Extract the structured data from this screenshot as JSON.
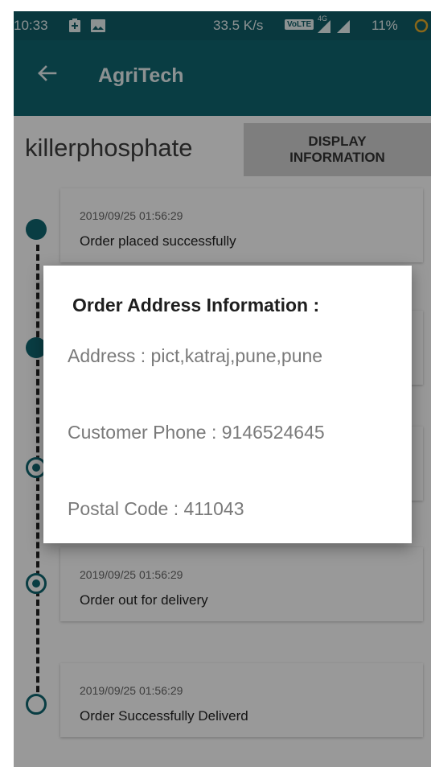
{
  "status_bar": {
    "time": "10:33",
    "speed": "33.5 K/s",
    "network_badge": "VoLTE",
    "signal_label": "4G",
    "battery": "11%"
  },
  "app_bar": {
    "title": "AgriTech"
  },
  "header": {
    "product_name": "killerphosphate",
    "display_button": "DISPLAY\nINFORMATION"
  },
  "timeline": [
    {
      "timestamp": "2019/09/25 01:56:29",
      "status": "Order placed successfully"
    },
    {
      "timestamp": "2019/09/25 01:56:29",
      "status": "Order out for delivery"
    },
    {
      "timestamp": "2019/09/25 01:56:29",
      "status": "Order Successfully Deliverd"
    }
  ],
  "dialog": {
    "title": "Order Address Information :",
    "address": "Address : pict,katraj,pune,pune",
    "phone": "Customer Phone : 9146524645",
    "postal": "Postal Code : 411043"
  },
  "colors": {
    "primary": "#0f6670",
    "status_bar": "#0f5e68"
  }
}
